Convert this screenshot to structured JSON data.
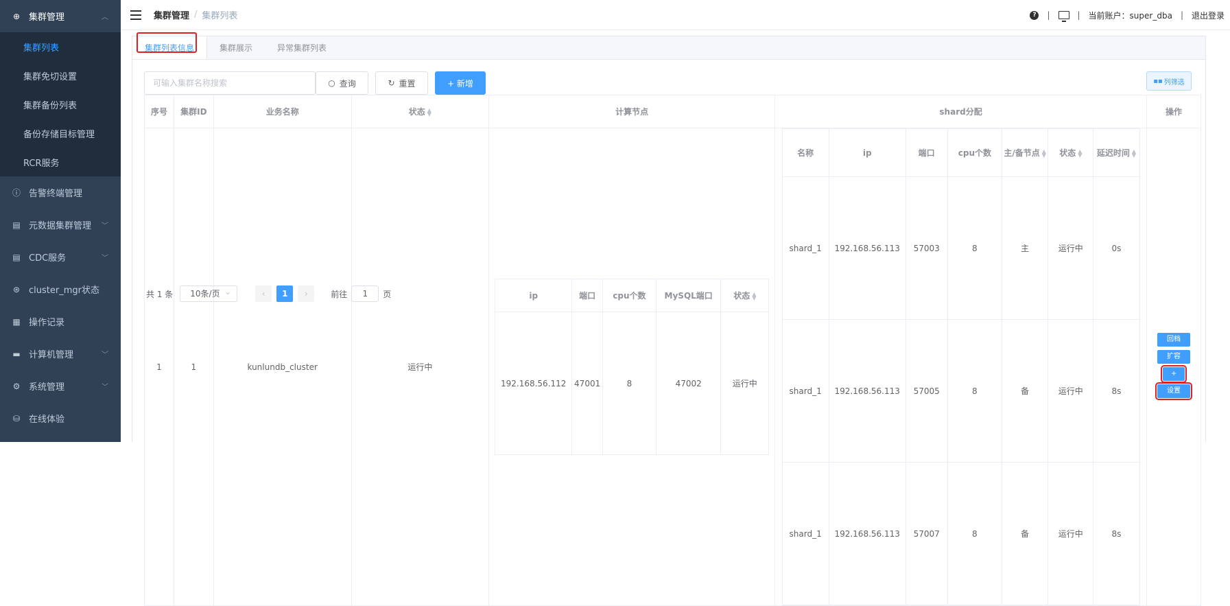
{
  "sidebar": {
    "groups": [
      {
        "label": "集群管理",
        "icon": "plus-circle-icon",
        "open": true,
        "items": [
          "集群列表",
          "集群免切设置",
          "集群备份列表",
          "备份存储目标管理",
          "RCR服务"
        ],
        "active": 0
      },
      {
        "label": "告警终端管理",
        "icon": "info-circle-icon"
      },
      {
        "label": "元数据集群管理",
        "icon": "storage-icon"
      },
      {
        "label": "CDC服务",
        "icon": "storage-icon"
      },
      {
        "label": "cluster_mgr状态",
        "icon": "aperture-icon"
      },
      {
        "label": "操作记录",
        "icon": "document-icon"
      },
      {
        "label": "计算机管理",
        "icon": "monitor-icon"
      },
      {
        "label": "系统管理",
        "icon": "gear-icon"
      },
      {
        "label": "在线体验",
        "icon": "database-icon"
      }
    ]
  },
  "header": {
    "breadcrumb": [
      "集群管理",
      "集群列表"
    ],
    "account_label": "当前账户：super_dba",
    "logout": "退出登录"
  },
  "tabs": [
    "集群列表信息",
    "集群展示",
    "异常集群列表"
  ],
  "toolbar": {
    "search_placeholder": "可输入集群名称搜索",
    "query": "查询",
    "reset": "重置",
    "add": "+ 新增",
    "column_filter": "列筛选"
  },
  "table": {
    "headers": [
      "序号",
      "集群ID",
      "业务名称",
      "状态",
      "计算节点",
      "shard分配",
      "操作"
    ],
    "row": {
      "index": "1",
      "cluster_id": "1",
      "name": "kunlundb_cluster",
      "status": "运行中"
    },
    "compute": {
      "headers": [
        "ip",
        "端口",
        "cpu个数",
        "MySQL端口",
        "状态"
      ],
      "rows": [
        {
          "ip": "192.168.56.112",
          "port": "47001",
          "cpu": "8",
          "mysql_port": "47002",
          "status": "运行中"
        }
      ]
    },
    "shard": {
      "headers": [
        "名称",
        "ip",
        "端口",
        "cpu个数",
        "主/备节点",
        "状态",
        "延迟时间"
      ],
      "rows": [
        {
          "name": "shard_1",
          "ip": "192.168.56.113",
          "port": "57003",
          "cpu": "8",
          "role": "主",
          "status": "运行中",
          "delay": "0s"
        },
        {
          "name": "shard_1",
          "ip": "192.168.56.113",
          "port": "57005",
          "cpu": "8",
          "role": "备",
          "status": "运行中",
          "delay": "8s"
        },
        {
          "name": "shard_1",
          "ip": "192.168.56.113",
          "port": "57007",
          "cpu": "8",
          "role": "备",
          "status": "运行中",
          "delay": "8s"
        }
      ]
    },
    "ops": [
      "回档",
      "扩容",
      "+",
      "设置"
    ]
  },
  "pagination": {
    "total": "共 1 条",
    "page_size": "10条/页",
    "current": "1",
    "goto_label": "前往",
    "goto_value": "1",
    "page_suffix": "页"
  },
  "colors": {
    "sidebar": "#304156",
    "primary": "#409eff",
    "success": "#67c23a",
    "highlight": "#e02020"
  }
}
